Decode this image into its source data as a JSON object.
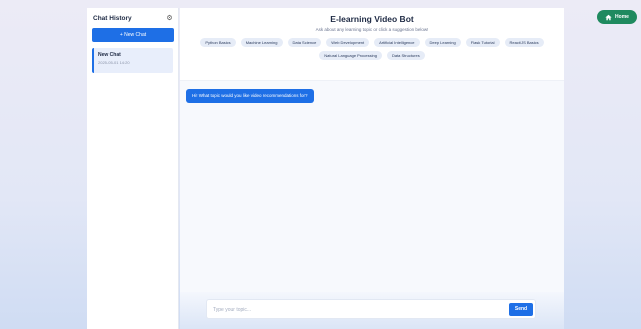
{
  "sidebar": {
    "title": "Chat History",
    "new_chat_label": "+ New Chat",
    "chats": [
      {
        "title": "New Chat",
        "date": "2025-05-01 14:20"
      }
    ]
  },
  "header": {
    "title": "E-learning Video Bot",
    "subtitle": "Ask about any learning topic or click a suggestion below!"
  },
  "topics": [
    "Python Basics",
    "Machine Learning",
    "Data Science",
    "Web Development",
    "Artificial Intelligence",
    "Deep Learning",
    "Flask Tutorial",
    "React/JS Basics",
    "Natural Language Processing",
    "Data Structures"
  ],
  "messages": [
    {
      "role": "bot",
      "text": "Hi! What topic would you like video recommendations for?"
    }
  ],
  "composer": {
    "placeholder": "Type your topic...",
    "send_label": "Send"
  },
  "home": {
    "label": "Home"
  },
  "colors": {
    "accent": "#1e6fe6",
    "home": "#1f8a5f"
  }
}
